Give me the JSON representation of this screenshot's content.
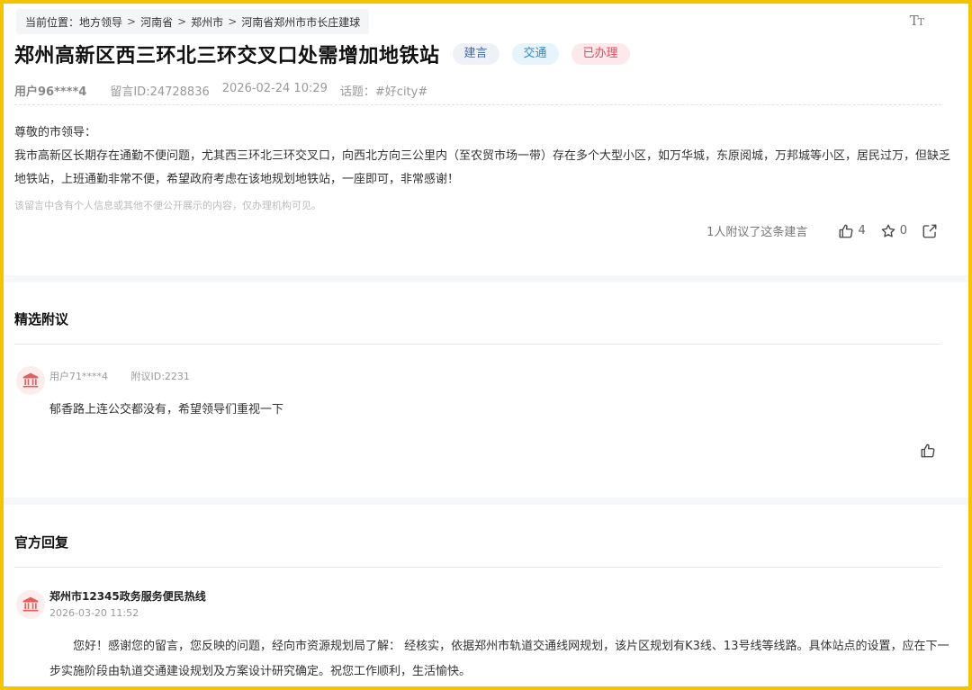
{
  "breadcrumb": {
    "prefix": "当前位置：",
    "items": [
      "地方领导",
      "河南省",
      "郑州市",
      "河南省郑州市市长庄建球"
    ],
    "separator": ">"
  },
  "font_toggle": {
    "big": "T",
    "small": "T"
  },
  "message": {
    "title": "郑州高新区西三环北三环交叉口处需增加地铁站",
    "tags": {
      "type": "建言",
      "category": "交通",
      "status": "已办理"
    },
    "user": "用户96****4",
    "id": "留言ID:24728836",
    "datetime": "2026-02-24 10:29",
    "topic": "话题：#好city#",
    "greeting": "尊敬的市领导：",
    "body": "我市高新区长期存在通勤不便问题，尤其西三环北三环交叉口，向西北方向三公里内（至农贸市场一带）存在多个大型小区，如万华城，东原阅城，万邦城等小区，居民过万，但缺乏地铁站，上班通勤非常不便，希望政府考虑在该地规划地铁站，一座即可，非常感谢！",
    "privacy_note": "该留言中含有个人信息或其他不便公开展示的内容，仅办理机构可见。",
    "endorse_text": "1人附议了这条建言",
    "like_count": "4",
    "favorite_count": "0"
  },
  "featured": {
    "section_title": "精选附议",
    "comment": {
      "user": "用户71****4",
      "id": "附议ID:2231",
      "text": "郁香路上连公交都没有，希望领导们重视一下"
    }
  },
  "official": {
    "section_title": "官方回复",
    "org": "郑州市12345政务服务便民热线",
    "date": "2026-03-20 11:52",
    "reply": "您好！感谢您的留言，您反映的问题，经向市资源规划局了解： 经核实，依据郑州市轨道交通线网规划，该片区规划有K3线、13号线等线路。具体站点的设置，应在下一步实施阶段由轨道交通建设规划及方案设计研究确定。祝您工作顺利，生活愉快。"
  },
  "colors": {
    "frame_border": "#f5c400",
    "status_red": "#e04a5b",
    "category_blue": "#2f8bc9",
    "avatar_bg": "#fdecec",
    "avatar_icon": "#e06060"
  }
}
